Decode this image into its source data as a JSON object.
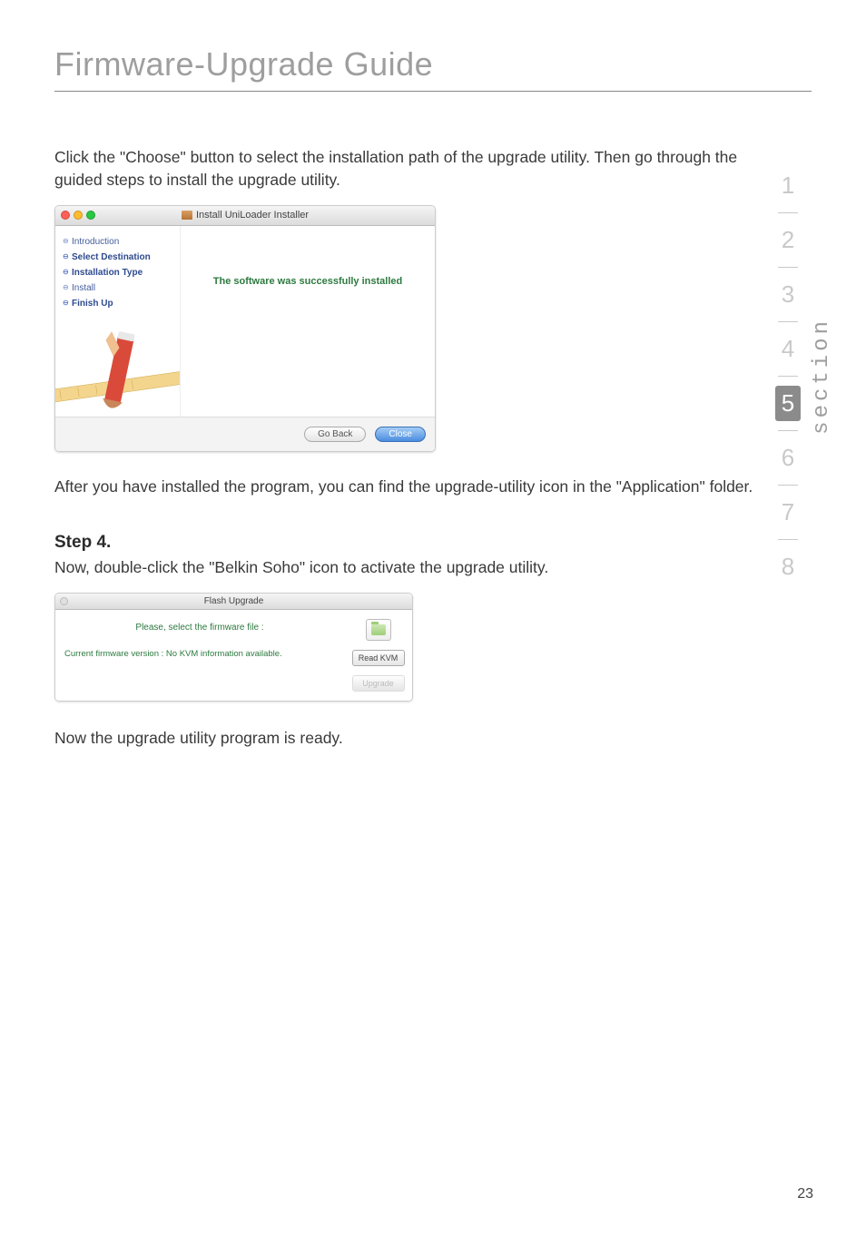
{
  "page": {
    "title": "Firmware-Upgrade Guide",
    "number": "23"
  },
  "nav": {
    "items": [
      "1",
      "2",
      "3",
      "4",
      "5",
      "6",
      "7",
      "8"
    ],
    "active_index": 4,
    "label": "section"
  },
  "content": {
    "intro_para": "Click the \"Choose\" button to select the installation path of the upgrade utility. Then go through the guided steps to install the upgrade utility.",
    "after_install_para": "After you have installed the program, you can find the upgrade-utility icon in the \"Application\" folder.",
    "step4_heading": "Step 4.",
    "step4_para": "Now, double-click the \"Belkin Soho\" icon to activate the upgrade utility.",
    "ready_para": "Now the upgrade utility program is ready."
  },
  "installer": {
    "title": "Install UniLoader Installer",
    "steps": {
      "introduction": "Introduction",
      "select_destination": "Select Destination",
      "installation_type": "Installation Type",
      "install": "Install",
      "finish_up": "Finish Up"
    },
    "success": "The software was successfully installed",
    "go_back": "Go Back",
    "close": "Close"
  },
  "flash": {
    "title": "Flash Upgrade",
    "prompt": "Please, select the firmware file :",
    "version": "Current firmware version : No KVM information available.",
    "read_kvm": "Read KVM",
    "upgrade": "Upgrade"
  }
}
